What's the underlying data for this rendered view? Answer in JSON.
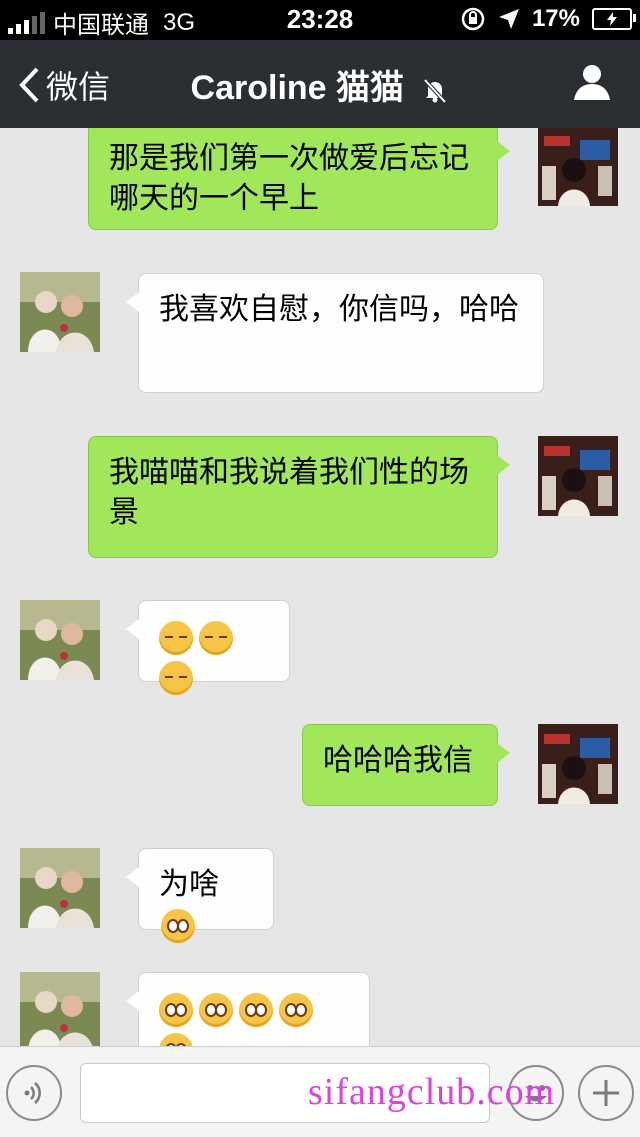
{
  "status_bar": {
    "carrier": "中国联通",
    "network": "3G",
    "time": "23:28",
    "battery": "17%"
  },
  "nav": {
    "back_label": "微信",
    "title": "Caroline 猫猫"
  },
  "messages": [
    {
      "side": "right",
      "text": "那是我们第一次做爱后忘记哪天的一个早上"
    },
    {
      "side": "left",
      "text": "我喜欢自慰，你信吗，哈哈"
    },
    {
      "side": "right",
      "text": "我喵喵和我说着我们性的场景"
    },
    {
      "side": "left",
      "emoji": [
        "thinking-emoji",
        "thinking-emoji",
        "thinking-emoji"
      ]
    },
    {
      "side": "right",
      "text": "哈哈哈我信"
    },
    {
      "side": "left",
      "text": "为啥",
      "emoji": [
        "shocked-emoji"
      ]
    },
    {
      "side": "left",
      "emoji": [
        "shocked-emoji",
        "shocked-emoji",
        "shocked-emoji",
        "shocked-emoji",
        "shocked-emoji"
      ]
    }
  ],
  "input": {
    "placeholder": ""
  },
  "watermark": "sifangclub.com",
  "colors": {
    "nav_bg": "#2b2e33",
    "chat_bg": "#e6e6e6",
    "bubble_green": "#a0e75a",
    "bubble_white": "#fefefe"
  }
}
